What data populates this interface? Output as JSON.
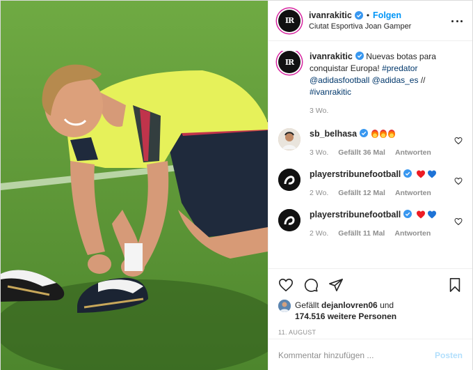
{
  "header": {
    "username": "ivanrakitic",
    "separator": "•",
    "follow_label": "Folgen",
    "location": "Ciutat Esportiva Joan Gamper",
    "avatar_monogram": "IR"
  },
  "caption": {
    "username": "ivanrakitic",
    "text": "Nuevas botas para conquistar Europa!",
    "tags": [
      "#predator",
      "@adidasfootball",
      "@adidas_es",
      "//",
      "#ivanrakitic"
    ],
    "time": "3 Wo."
  },
  "comments": [
    {
      "username": "sb_belhasa",
      "emoji": "fire×3",
      "time": "3 Wo.",
      "likes": "Gefällt 36 Mal",
      "reply": "Antworten"
    },
    {
      "username": "playerstribunefootball",
      "emoji": "red-heart blue-heart",
      "time": "2 Wo.",
      "likes": "Gefällt 12 Mal",
      "reply": "Antworten"
    },
    {
      "username": "playerstribunefootball",
      "emoji": "red-heart blue-heart",
      "time": "2 Wo.",
      "likes": "Gefällt 11 Mal",
      "reply": "Antworten"
    }
  ],
  "likes": {
    "prefix": "Gefällt",
    "user": "dejanlovren06",
    "connector": "und",
    "others": "174.516 weitere Personen"
  },
  "date": "11. AUGUST",
  "add_comment": {
    "placeholder": "Kommentar hinzufügen ...",
    "post_label": "Posten"
  },
  "colors": {
    "accent": "#0095f6",
    "tag": "#00376b",
    "muted": "#8e8e8e",
    "verified": "#3897f0",
    "heart_red": "#ed1c24",
    "heart_blue": "#1e73d6"
  }
}
